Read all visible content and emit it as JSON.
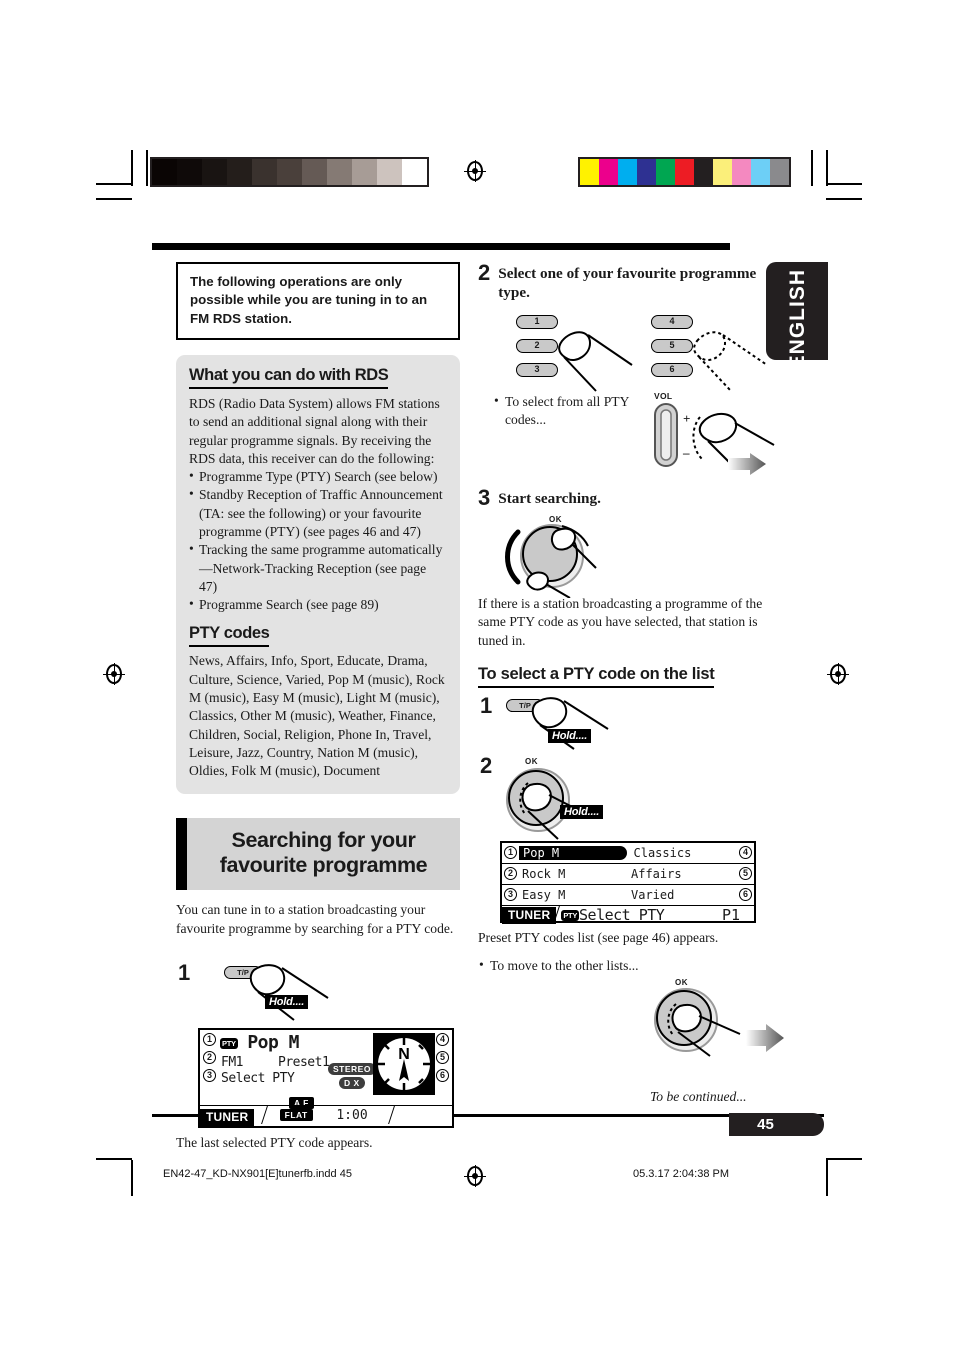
{
  "language_tab": "ENGLISH",
  "page_number": "45",
  "to_be_continued": "To be continued...",
  "footer": {
    "file": "EN42-47_KD-NX901[E]tunerfb.indd   45",
    "timestamp": "05.3.17   2:04:38 PM"
  },
  "calibration": {
    "grayscale": [
      "#0a0504",
      "#0f0a09",
      "#191412",
      "#241e1b",
      "#3a322e",
      "#4a403b",
      "#655a55",
      "#857a74",
      "#a79c96",
      "#cdc3be",
      "#ffffff"
    ],
    "color": [
      "#fff200",
      "#ec008c",
      "#00aeef",
      "#2e3192",
      "#00a651",
      "#ed1c24",
      "#231f20",
      "#fbef7a",
      "#f489c0",
      "#6dcff6",
      "#8a8a8d"
    ]
  },
  "notice": "The following operations are only possible while you are tuning in to an FM RDS station.",
  "rds_section": {
    "heading": "What you can do with RDS",
    "intro": "RDS (Radio Data System) allows FM stations to send an additional signal along with their regular programme signals. By receiving the RDS data, this receiver can do the following:",
    "bullets": [
      "Programme Type (PTY) Search (see below)",
      "Standby Reception of Traffic Announcement (TA: see the following) or your favourite programme (PTY) (see pages 46 and 47)",
      "Tracking the same programme automatically —Network-Tracking Reception (see page 47)",
      "Programme Search (see page 89)"
    ],
    "pty_heading": "PTY codes",
    "pty_codes": "News, Affairs, Info, Sport, Educate, Drama, Culture, Science, Varied, Pop M (music), Rock M (music), Easy M (music), Light M (music), Classics, Other M (music), Weather, Finance, Children, Social, Religion, Phone In, Travel, Leisure, Jazz, Country, Nation M (music), Oldies, Folk M (music), Document"
  },
  "search_section": {
    "title": "Searching for your favourite programme",
    "intro": "You can tune in to a station broadcasting your favourite programme by searching for a PTY code.",
    "step1_num": "1",
    "step1_button": "T/P",
    "step1_hold": "Hold....",
    "step1_caption": "The last selected PTY code appears."
  },
  "lcd_main": {
    "pty_chip": "PTY",
    "pty_name": "Pop M",
    "band": "FM1",
    "preset": "Preset1",
    "mode_line": "Select PTY",
    "stereo": "STEREO",
    "dx": "D X",
    "af": "A F",
    "source": "TUNER",
    "eq": "FLAT",
    "clock": "1:00",
    "compass": "N",
    "left_numbers": [
      "1",
      "2",
      "3"
    ],
    "right_numbers": [
      "4",
      "5",
      "6"
    ]
  },
  "right_col": {
    "step2_num": "2",
    "step2_text": "Select one of your favourite programme type.",
    "preset_buttons_left": [
      "1",
      "2",
      "3"
    ],
    "preset_buttons_right": [
      "4",
      "5",
      "6"
    ],
    "step2_bullet": "To select from all PTY codes...",
    "vol_label": "VOL",
    "vol_plus": "+",
    "vol_minus": "–",
    "step3_num": "3",
    "step3_text": "Start searching.",
    "ok_label": "OK",
    "step3_caption": "If there is a station broadcasting a programme of the same PTY code as you have selected, that station is tuned in.",
    "list_heading": "To select a PTY code on the list",
    "list_step1_num": "1",
    "list_step1_button": "T/P",
    "list_step1_hold": "Hold....",
    "list_step2_num": "2",
    "list_step2_hold": "Hold....",
    "list_caption": "Preset PTY codes list (see page 46) appears.",
    "list_bullet": "To move to the other lists..."
  },
  "lcd_list": {
    "rows": [
      {
        "num": "1",
        "left": "Pop M",
        "right": "Classics",
        "rnum": "4",
        "highlight": true
      },
      {
        "num": "2",
        "left": "Rock M",
        "right": "Affairs",
        "rnum": "5",
        "highlight": false
      },
      {
        "num": "3",
        "left": "Easy M",
        "right": "Varied",
        "rnum": "6",
        "highlight": false
      }
    ],
    "source": "TUNER",
    "pty_chip": "PTY",
    "mode": "Select PTY",
    "page": "P1"
  }
}
